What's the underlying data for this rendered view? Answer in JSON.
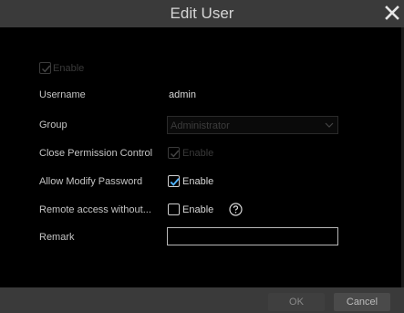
{
  "dialog": {
    "title": "Edit User"
  },
  "form": {
    "enable": {
      "label": "Enable",
      "checked": true,
      "disabled": true
    },
    "username": {
      "label": "Username",
      "value": "admin"
    },
    "group": {
      "label": "Group",
      "value": "Administrator",
      "disabled": true
    },
    "close_permission_control": {
      "label": "Close Permission Control",
      "checkbox_label": "Enable",
      "checked": true,
      "disabled": true
    },
    "allow_modify_password": {
      "label": "Allow Modify Password",
      "checkbox_label": "Enable",
      "checked": true
    },
    "remote_access": {
      "label": "Remote access without...",
      "checkbox_label": "Enable",
      "checked": false,
      "help_icon": "question-circle-icon"
    },
    "remark": {
      "label": "Remark",
      "value": ""
    }
  },
  "footer": {
    "ok_label": "OK",
    "cancel_label": "Cancel"
  },
  "icons": {
    "close": "close-icon",
    "dropdown": "chevron-down-icon",
    "check": "checkmark-icon"
  },
  "colors": {
    "titlebar": "#3a3a3a",
    "body": "#000000",
    "check_accent": "#4fb3ff"
  }
}
